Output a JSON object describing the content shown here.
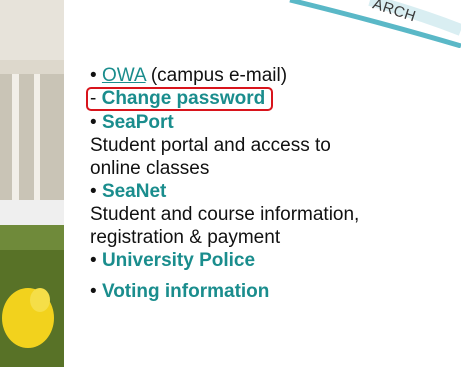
{
  "banner": {
    "label": "ARCH"
  },
  "links": {
    "owa": {
      "bullet": "•",
      "label": "OWA",
      "suffix": "(campus e-mail)"
    },
    "change_password": {
      "prefix": "-",
      "label": "Change password"
    },
    "seaport": {
      "bullet": "•",
      "label": "SeaPort",
      "desc_1": "Student portal and access to",
      "desc_2": "online classes"
    },
    "seanet": {
      "bullet": "•",
      "label": "SeaNet",
      "desc_1": "Student and course information,",
      "desc_2": "registration & payment"
    },
    "police": {
      "bullet": "•",
      "label": "University Police"
    },
    "voting": {
      "bullet": "•",
      "label": "Voting information"
    }
  },
  "colors": {
    "link": "#1a8d8d",
    "highlight_box": "#d8141c",
    "text": "#111111"
  }
}
